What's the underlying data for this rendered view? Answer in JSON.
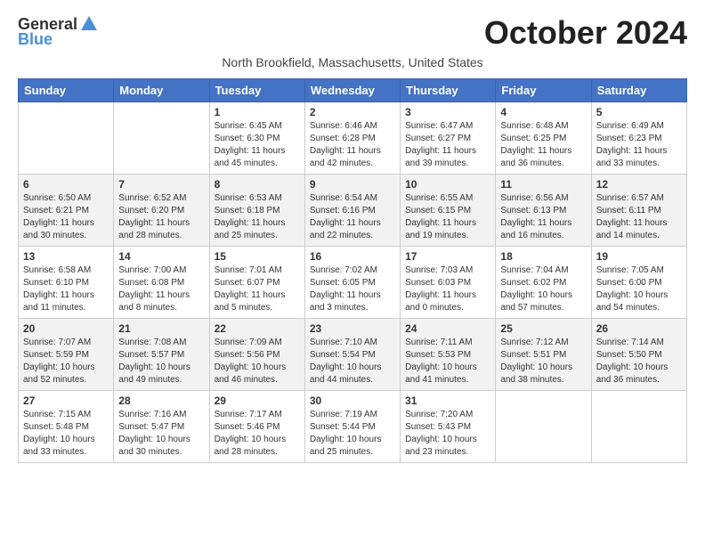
{
  "header": {
    "logo_general": "General",
    "logo_blue": "Blue",
    "title": "October 2024",
    "subtitle": "North Brookfield, Massachusetts, United States"
  },
  "days_of_week": [
    "Sunday",
    "Monday",
    "Tuesday",
    "Wednesday",
    "Thursday",
    "Friday",
    "Saturday"
  ],
  "weeks": [
    [
      {
        "num": "",
        "sunrise": "",
        "sunset": "",
        "daylight": ""
      },
      {
        "num": "",
        "sunrise": "",
        "sunset": "",
        "daylight": ""
      },
      {
        "num": "1",
        "sunrise": "Sunrise: 6:45 AM",
        "sunset": "Sunset: 6:30 PM",
        "daylight": "Daylight: 11 hours and 45 minutes."
      },
      {
        "num": "2",
        "sunrise": "Sunrise: 6:46 AM",
        "sunset": "Sunset: 6:28 PM",
        "daylight": "Daylight: 11 hours and 42 minutes."
      },
      {
        "num": "3",
        "sunrise": "Sunrise: 6:47 AM",
        "sunset": "Sunset: 6:27 PM",
        "daylight": "Daylight: 11 hours and 39 minutes."
      },
      {
        "num": "4",
        "sunrise": "Sunrise: 6:48 AM",
        "sunset": "Sunset: 6:25 PM",
        "daylight": "Daylight: 11 hours and 36 minutes."
      },
      {
        "num": "5",
        "sunrise": "Sunrise: 6:49 AM",
        "sunset": "Sunset: 6:23 PM",
        "daylight": "Daylight: 11 hours and 33 minutes."
      }
    ],
    [
      {
        "num": "6",
        "sunrise": "Sunrise: 6:50 AM",
        "sunset": "Sunset: 6:21 PM",
        "daylight": "Daylight: 11 hours and 30 minutes."
      },
      {
        "num": "7",
        "sunrise": "Sunrise: 6:52 AM",
        "sunset": "Sunset: 6:20 PM",
        "daylight": "Daylight: 11 hours and 28 minutes."
      },
      {
        "num": "8",
        "sunrise": "Sunrise: 6:53 AM",
        "sunset": "Sunset: 6:18 PM",
        "daylight": "Daylight: 11 hours and 25 minutes."
      },
      {
        "num": "9",
        "sunrise": "Sunrise: 6:54 AM",
        "sunset": "Sunset: 6:16 PM",
        "daylight": "Daylight: 11 hours and 22 minutes."
      },
      {
        "num": "10",
        "sunrise": "Sunrise: 6:55 AM",
        "sunset": "Sunset: 6:15 PM",
        "daylight": "Daylight: 11 hours and 19 minutes."
      },
      {
        "num": "11",
        "sunrise": "Sunrise: 6:56 AM",
        "sunset": "Sunset: 6:13 PM",
        "daylight": "Daylight: 11 hours and 16 minutes."
      },
      {
        "num": "12",
        "sunrise": "Sunrise: 6:57 AM",
        "sunset": "Sunset: 6:11 PM",
        "daylight": "Daylight: 11 hours and 14 minutes."
      }
    ],
    [
      {
        "num": "13",
        "sunrise": "Sunrise: 6:58 AM",
        "sunset": "Sunset: 6:10 PM",
        "daylight": "Daylight: 11 hours and 11 minutes."
      },
      {
        "num": "14",
        "sunrise": "Sunrise: 7:00 AM",
        "sunset": "Sunset: 6:08 PM",
        "daylight": "Daylight: 11 hours and 8 minutes."
      },
      {
        "num": "15",
        "sunrise": "Sunrise: 7:01 AM",
        "sunset": "Sunset: 6:07 PM",
        "daylight": "Daylight: 11 hours and 5 minutes."
      },
      {
        "num": "16",
        "sunrise": "Sunrise: 7:02 AM",
        "sunset": "Sunset: 6:05 PM",
        "daylight": "Daylight: 11 hours and 3 minutes."
      },
      {
        "num": "17",
        "sunrise": "Sunrise: 7:03 AM",
        "sunset": "Sunset: 6:03 PM",
        "daylight": "Daylight: 11 hours and 0 minutes."
      },
      {
        "num": "18",
        "sunrise": "Sunrise: 7:04 AM",
        "sunset": "Sunset: 6:02 PM",
        "daylight": "Daylight: 10 hours and 57 minutes."
      },
      {
        "num": "19",
        "sunrise": "Sunrise: 7:05 AM",
        "sunset": "Sunset: 6:00 PM",
        "daylight": "Daylight: 10 hours and 54 minutes."
      }
    ],
    [
      {
        "num": "20",
        "sunrise": "Sunrise: 7:07 AM",
        "sunset": "Sunset: 5:59 PM",
        "daylight": "Daylight: 10 hours and 52 minutes."
      },
      {
        "num": "21",
        "sunrise": "Sunrise: 7:08 AM",
        "sunset": "Sunset: 5:57 PM",
        "daylight": "Daylight: 10 hours and 49 minutes."
      },
      {
        "num": "22",
        "sunrise": "Sunrise: 7:09 AM",
        "sunset": "Sunset: 5:56 PM",
        "daylight": "Daylight: 10 hours and 46 minutes."
      },
      {
        "num": "23",
        "sunrise": "Sunrise: 7:10 AM",
        "sunset": "Sunset: 5:54 PM",
        "daylight": "Daylight: 10 hours and 44 minutes."
      },
      {
        "num": "24",
        "sunrise": "Sunrise: 7:11 AM",
        "sunset": "Sunset: 5:53 PM",
        "daylight": "Daylight: 10 hours and 41 minutes."
      },
      {
        "num": "25",
        "sunrise": "Sunrise: 7:12 AM",
        "sunset": "Sunset: 5:51 PM",
        "daylight": "Daylight: 10 hours and 38 minutes."
      },
      {
        "num": "26",
        "sunrise": "Sunrise: 7:14 AM",
        "sunset": "Sunset: 5:50 PM",
        "daylight": "Daylight: 10 hours and 36 minutes."
      }
    ],
    [
      {
        "num": "27",
        "sunrise": "Sunrise: 7:15 AM",
        "sunset": "Sunset: 5:48 PM",
        "daylight": "Daylight: 10 hours and 33 minutes."
      },
      {
        "num": "28",
        "sunrise": "Sunrise: 7:16 AM",
        "sunset": "Sunset: 5:47 PM",
        "daylight": "Daylight: 10 hours and 30 minutes."
      },
      {
        "num": "29",
        "sunrise": "Sunrise: 7:17 AM",
        "sunset": "Sunset: 5:46 PM",
        "daylight": "Daylight: 10 hours and 28 minutes."
      },
      {
        "num": "30",
        "sunrise": "Sunrise: 7:19 AM",
        "sunset": "Sunset: 5:44 PM",
        "daylight": "Daylight: 10 hours and 25 minutes."
      },
      {
        "num": "31",
        "sunrise": "Sunrise: 7:20 AM",
        "sunset": "Sunset: 5:43 PM",
        "daylight": "Daylight: 10 hours and 23 minutes."
      },
      {
        "num": "",
        "sunrise": "",
        "sunset": "",
        "daylight": ""
      },
      {
        "num": "",
        "sunrise": "",
        "sunset": "",
        "daylight": ""
      }
    ]
  ]
}
